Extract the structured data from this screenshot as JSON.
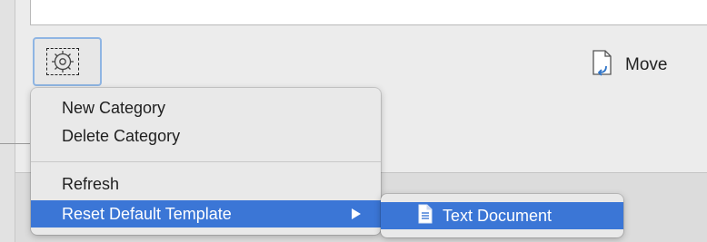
{
  "toolbar": {
    "gear_icon": "gear-icon",
    "move_label": "Move",
    "move_icon": "move-document-icon"
  },
  "context_menu": {
    "items": [
      {
        "label": "New Category"
      },
      {
        "label": "Delete Category"
      },
      {
        "label": "Refresh"
      },
      {
        "label": "Reset Default Template",
        "has_submenu": true,
        "highlighted": true
      }
    ]
  },
  "submenu": {
    "items": [
      {
        "label": "Text Document",
        "icon": "text-document-icon",
        "highlighted": true
      }
    ]
  },
  "colors": {
    "highlight": "#3b76d6",
    "menu_background": "#e9e9e9",
    "focus_ring": "#8fb5e3"
  }
}
